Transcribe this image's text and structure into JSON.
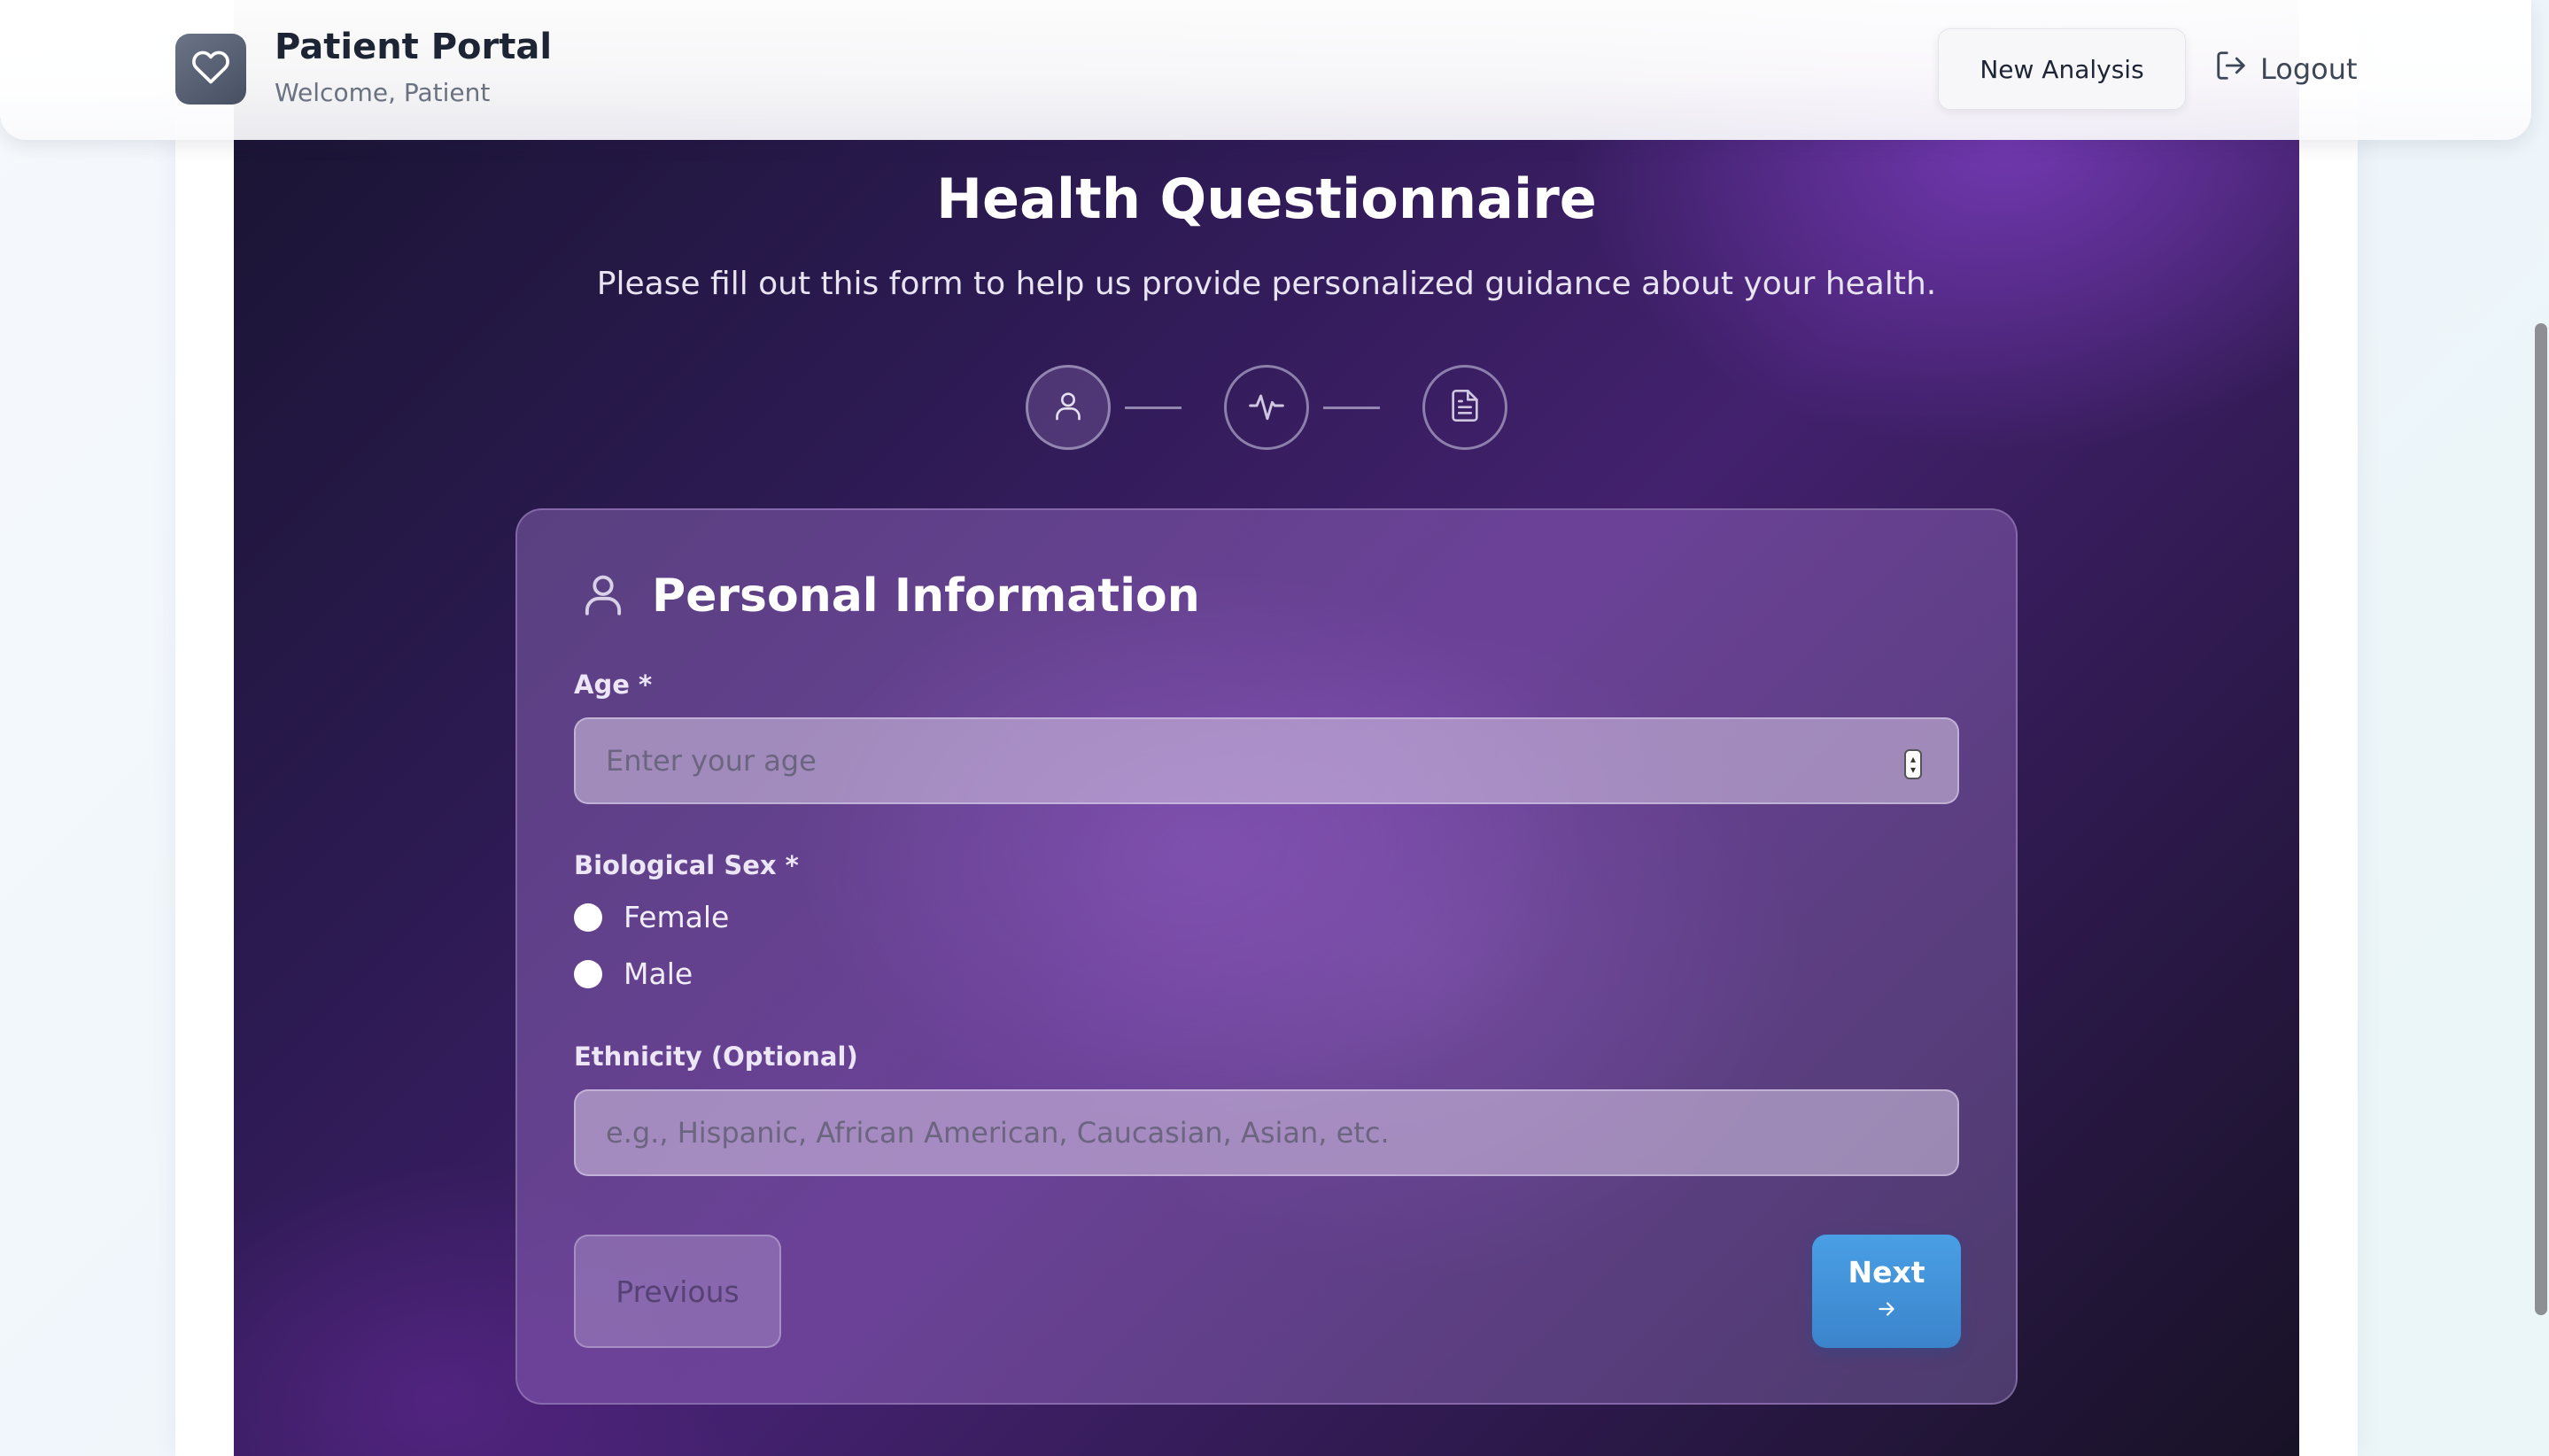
{
  "header": {
    "title": "Patient Portal",
    "subtitle": "Welcome, Patient",
    "new_analysis_label": "New Analysis",
    "logout_label": "Logout"
  },
  "page": {
    "title": "Health Questionnaire",
    "description": "Please fill out this form to help us provide personalized guidance about your health."
  },
  "steps": [
    {
      "icon": "user-icon",
      "active": true
    },
    {
      "icon": "activity-icon",
      "active": false
    },
    {
      "icon": "document-icon",
      "active": false
    }
  ],
  "form": {
    "section_title": "Personal Information",
    "age": {
      "label": "Age *",
      "placeholder": "Enter your age",
      "value": ""
    },
    "sex": {
      "label": "Biological Sex *",
      "options": [
        "Female",
        "Male"
      ],
      "selected": null
    },
    "ethnicity": {
      "label": "Ethnicity (Optional)",
      "placeholder": "e.g., Hispanic, African American, Caucasian, Asian, etc.",
      "value": ""
    },
    "previous_label": "Previous",
    "next_label": "Next",
    "next_icon": "arrow-right-icon"
  },
  "colors": {
    "accent": "#4a9fe4",
    "hero_dark": "#181430",
    "hero_purple": "#43216e",
    "logo_bg": "#5a6375"
  }
}
